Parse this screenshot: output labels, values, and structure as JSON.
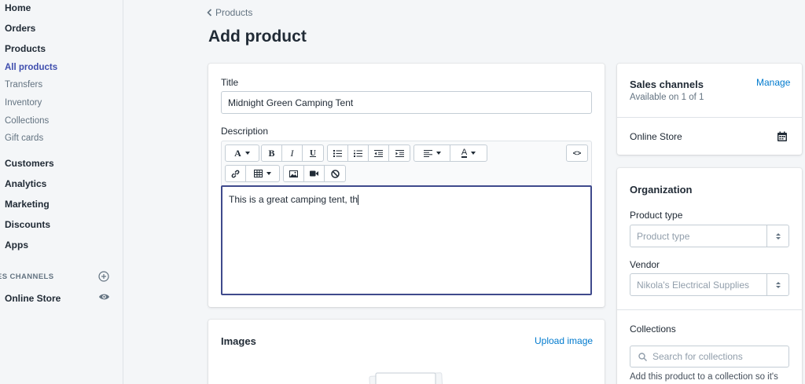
{
  "sidebar": {
    "items": [
      {
        "label": "Home"
      },
      {
        "label": "Orders"
      },
      {
        "label": "Products"
      },
      {
        "label": "Customers"
      },
      {
        "label": "Analytics"
      },
      {
        "label": "Marketing"
      },
      {
        "label": "Discounts"
      },
      {
        "label": "Apps"
      }
    ],
    "product_subitems": [
      {
        "label": "All products",
        "active": true
      },
      {
        "label": "Transfers"
      },
      {
        "label": "Inventory"
      },
      {
        "label": "Collections"
      },
      {
        "label": "Gift cards"
      }
    ],
    "sales_channels_heading": "ES CHANNELS",
    "online_store_label": "Online Store"
  },
  "header": {
    "breadcrumb": "Products",
    "title": "Add product"
  },
  "product_form": {
    "title_label": "Title",
    "title_value": "Midnight Green Camping Tent",
    "description_label": "Description",
    "description_value": "This is a great camping tent, th",
    "toolbar": {
      "font_label": "A",
      "bold": "B",
      "italic": "I",
      "underline": "U",
      "color_label": "A",
      "code_view": "<>"
    }
  },
  "images_card": {
    "title": "Images",
    "upload_link": "Upload image"
  },
  "sales_channels": {
    "title": "Sales channels",
    "manage_link": "Manage",
    "availability": "Available on 1 of 1",
    "channel": "Online Store"
  },
  "organization": {
    "title": "Organization",
    "product_type_label": "Product type",
    "product_type_placeholder": "Product type",
    "vendor_label": "Vendor",
    "vendor_placeholder": "Nikola's Electrical Supplies",
    "collections_label": "Collections",
    "collections_placeholder": "Search for collections",
    "collections_help": "Add this product to a collection so it's"
  },
  "colors": {
    "accent": "#3f4eae",
    "link": "#007ace",
    "editor_focus": "#3f4a8c"
  }
}
